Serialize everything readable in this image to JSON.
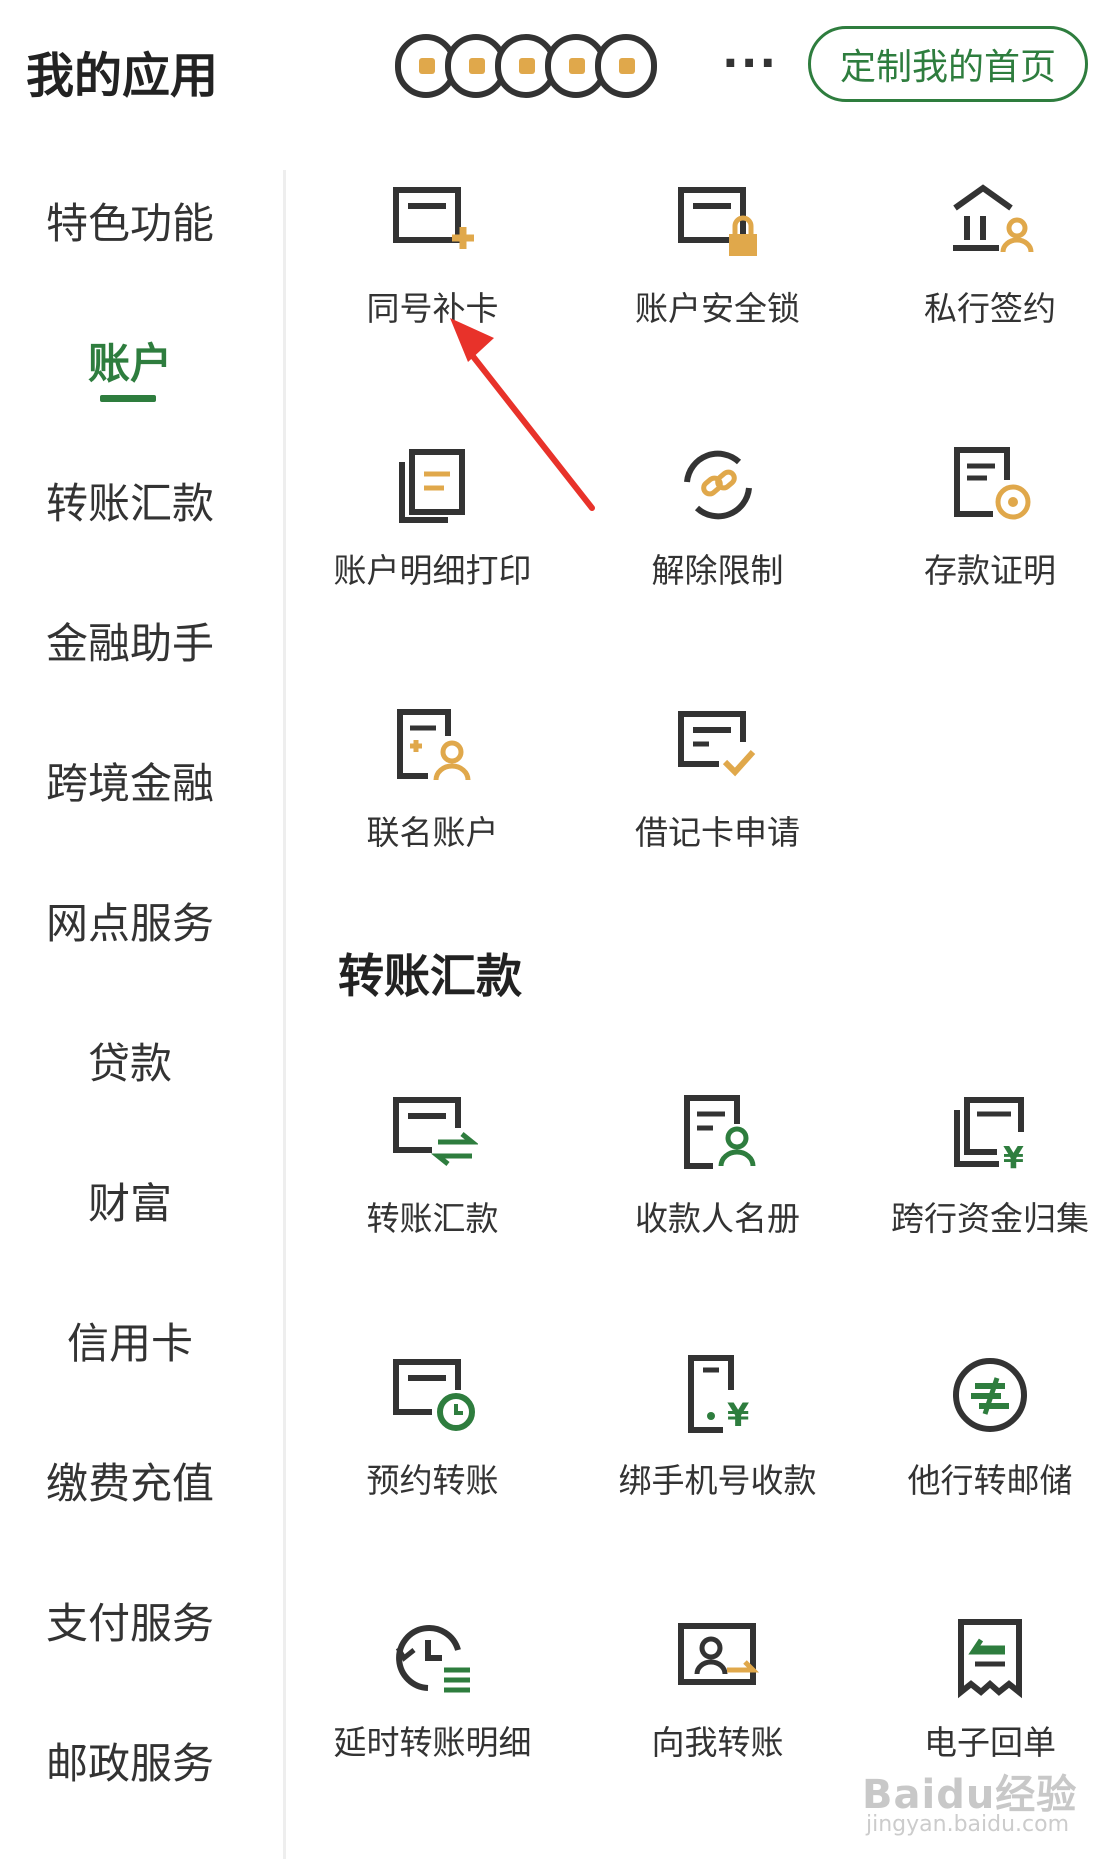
{
  "header": {
    "title": "我的应用",
    "more": "···",
    "customize_label": "定制我的首页"
  },
  "sidebar": {
    "items": [
      {
        "label": "特色功能",
        "active": false
      },
      {
        "label": "账户",
        "active": true
      },
      {
        "label": "转账汇款",
        "active": false
      },
      {
        "label": "金融助手",
        "active": false
      },
      {
        "label": "跨境金融",
        "active": false
      },
      {
        "label": "网点服务",
        "active": false
      },
      {
        "label": "贷款",
        "active": false
      },
      {
        "label": "财富",
        "active": false
      },
      {
        "label": "信用卡",
        "active": false
      },
      {
        "label": "缴费充值",
        "active": false
      },
      {
        "label": "支付服务",
        "active": false
      },
      {
        "label": "邮政服务",
        "active": false
      }
    ]
  },
  "account_section": {
    "items": [
      {
        "label": "同号补卡",
        "icon": "card-add-icon"
      },
      {
        "label": "账户安全锁",
        "icon": "card-lock-icon"
      },
      {
        "label": "私行签约",
        "icon": "bank-person-icon"
      },
      {
        "label": "账户明细打印",
        "icon": "document-stack-icon"
      },
      {
        "label": "解除限制",
        "icon": "unlink-icon"
      },
      {
        "label": "存款证明",
        "icon": "certificate-icon"
      },
      {
        "label": "联名账户",
        "icon": "joint-account-icon"
      },
      {
        "label": "借记卡申请",
        "icon": "card-check-icon"
      }
    ]
  },
  "transfer_section": {
    "title": "转账汇款",
    "items": [
      {
        "label": "转账汇款",
        "icon": "card-transfer-icon"
      },
      {
        "label": "收款人名册",
        "icon": "payee-book-icon"
      },
      {
        "label": "跨行资金归集",
        "icon": "fund-collect-icon"
      },
      {
        "label": "预约转账",
        "icon": "card-clock-icon"
      },
      {
        "label": "绑手机号收款",
        "icon": "phone-yuan-icon"
      },
      {
        "label": "他行转邮储",
        "icon": "postal-logo-icon"
      },
      {
        "label": "延时转账明细",
        "icon": "delay-history-icon"
      },
      {
        "label": "向我转账",
        "icon": "transfer-to-me-icon"
      },
      {
        "label": "电子回单",
        "icon": "e-receipt-icon"
      }
    ]
  },
  "watermark": {
    "text": "Baidu经验",
    "sub": "jingyan.baidu.com"
  },
  "colors": {
    "brand_green": "#2e7d3e",
    "icon_accent": "#e0a84b",
    "annotation_red": "#e8322a"
  }
}
